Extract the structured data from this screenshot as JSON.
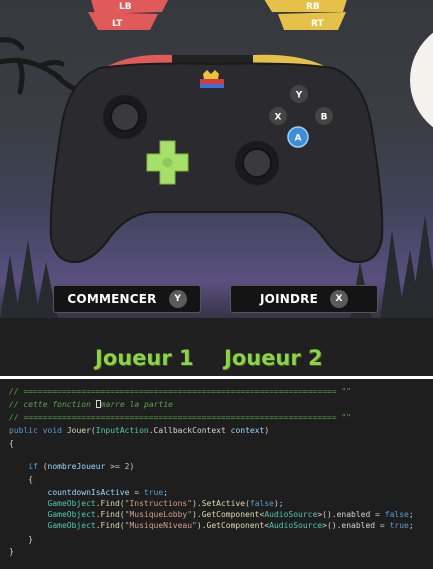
{
  "controller": {
    "bumpers": {
      "left_top": "LB",
      "left_bottom": "LT",
      "right_top": "RB",
      "right_bottom": "RT"
    },
    "face_buttons": {
      "y": "Y",
      "x": "X",
      "b": "B",
      "a": "A"
    }
  },
  "buttons": {
    "start": {
      "label": "COMMENCER",
      "badge": "Y"
    },
    "join": {
      "label": "JOINDRE",
      "badge": "X"
    }
  },
  "players": {
    "p1": "Joueur 1",
    "p2": "Joueur 2"
  },
  "code": {
    "l1": "// ================================================================= \"\"",
    "l2a": "// cette fonction ",
    "l2b": "marre la partie",
    "l3": "// ================================================================= \"\"",
    "l4_kw1": "public",
    "l4_kw2": "void",
    "l4_fn": "Jouer",
    "l4_ty": "InputAction",
    "l4_rest": ".CallbackContext",
    "l4_param": "context",
    "brace_open": "{",
    "if_kw": "if",
    "if_var": "nombreJoueur",
    "if_op": ">=",
    "if_num": "2",
    "assign_var": "countdownIsActive",
    "assign_val": "true",
    "go": "GameObject",
    "find": "Find",
    "s1": "\"Instructions\"",
    "setactive": "SetActive",
    "false_kw": "false",
    "s2": "\"MusiqueLobby\"",
    "s3": "\"MusiqueNiveau\"",
    "getcomp": "GetComponent",
    "audiosrc": "AudioSource",
    "enabled": "enabled",
    "true_kw": "true",
    "brace_close": "}"
  },
  "colors": {
    "green": "#8ed14a",
    "blue_a": "#3a8fd8",
    "red_bumper": "#e05a5a",
    "yellow_bumper": "#e6c14a"
  }
}
